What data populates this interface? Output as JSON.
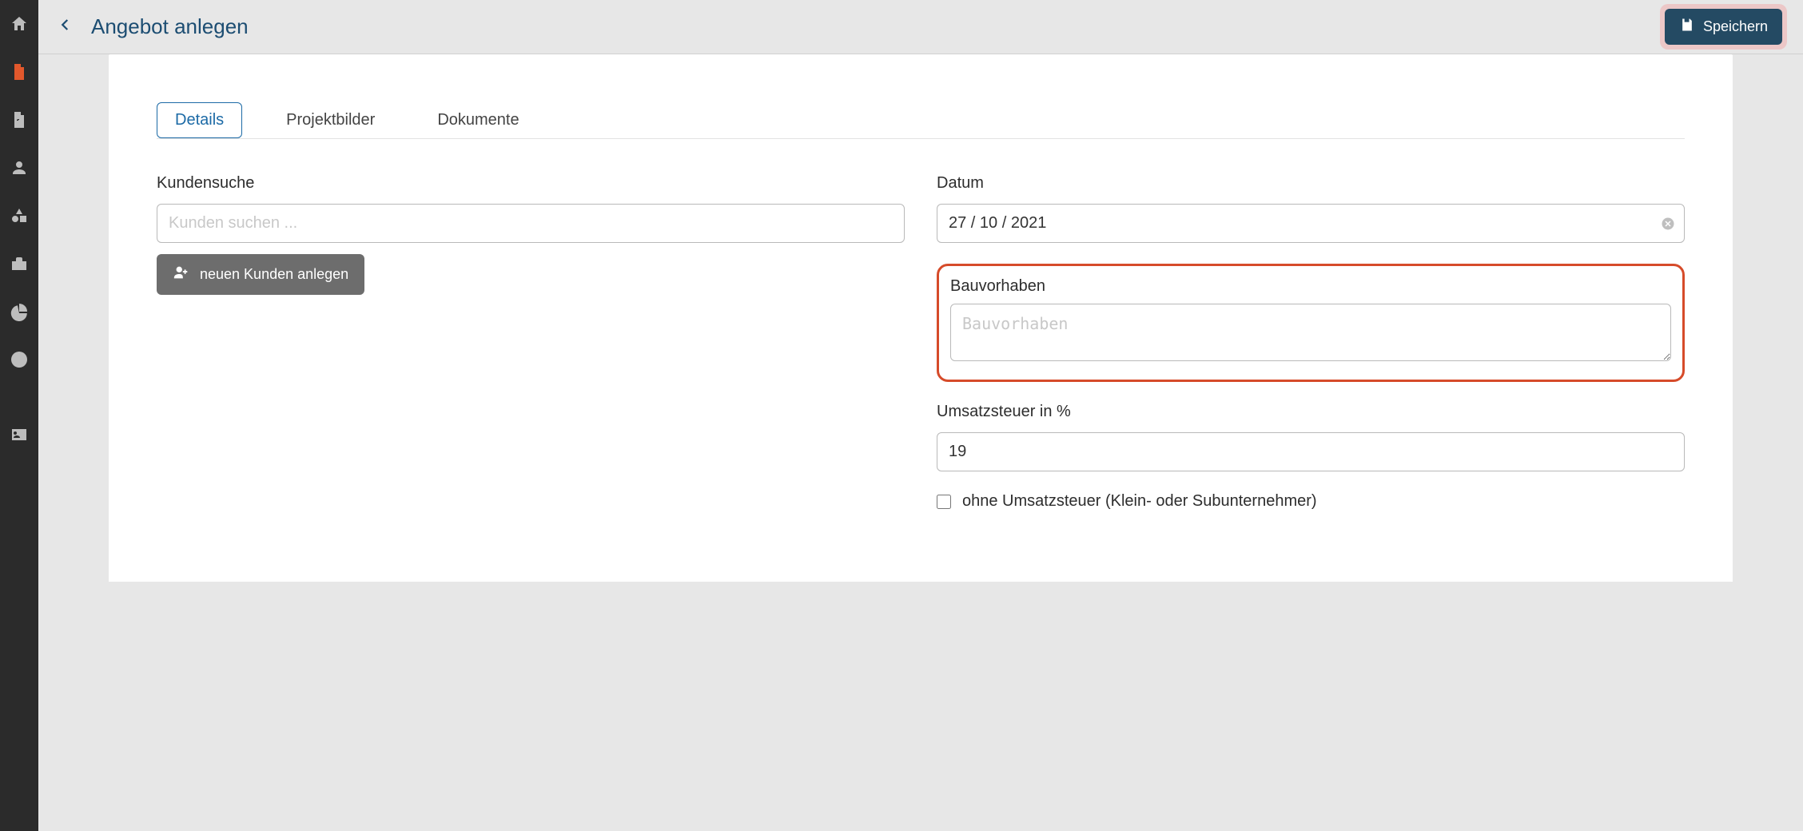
{
  "header": {
    "title": "Angebot anlegen",
    "save_label": "Speichern"
  },
  "tabs": {
    "details": "Details",
    "projektbilder": "Projektbilder",
    "dokumente": "Dokumente"
  },
  "left": {
    "kundensuche_label": "Kundensuche",
    "kundensuche_placeholder": "Kunden suchen ...",
    "neuer_kunde_label": "neuen Kunden anlegen"
  },
  "right": {
    "datum_label": "Datum",
    "datum_value": "27 / 10 / 2021",
    "bauvorhaben_label": "Bauvorhaben",
    "bauvorhaben_placeholder": "Bauvorhaben",
    "ust_label": "Umsatzsteuer in %",
    "ust_value": "19",
    "ohne_ust_label": "ohne Umsatzsteuer (Klein- oder Subunternehmer)"
  },
  "sidebar_icons": [
    "home-icon",
    "document-icon",
    "invoice-icon",
    "person-icon",
    "shapes-icon",
    "toolbox-icon",
    "piechart-icon",
    "clock-icon",
    "idcard-icon"
  ]
}
